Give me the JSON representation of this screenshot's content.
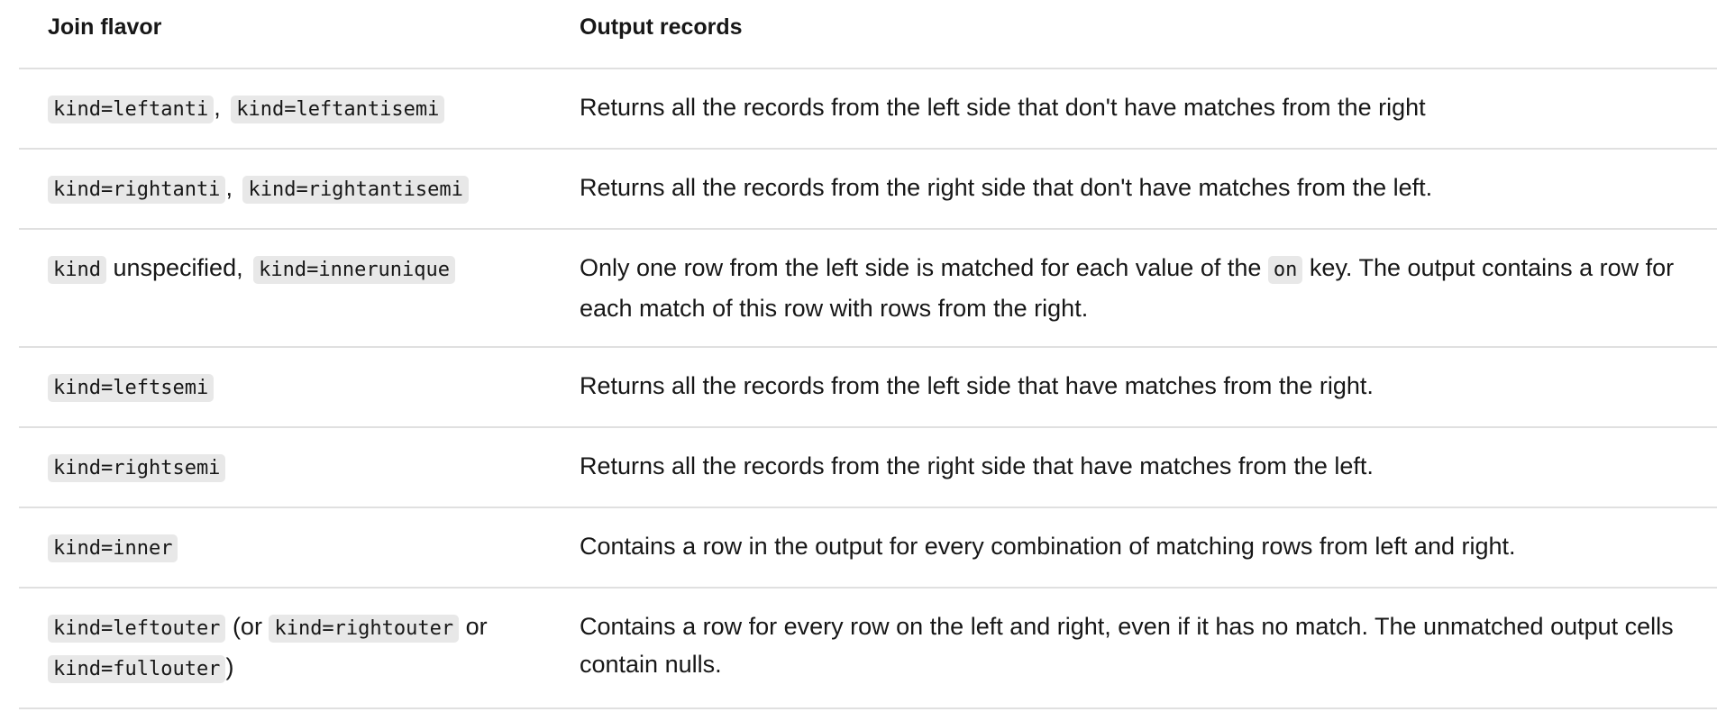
{
  "header": {
    "col1": "Join flavor",
    "col2": "Output records"
  },
  "rows": [
    {
      "flavor_code_1": "kind=leftanti",
      "flavor_sep_1": ",",
      "flavor_code_2": "kind=leftantisemi",
      "output": "Returns all the records from the left side that don't have matches from the right"
    },
    {
      "flavor_code_1": "kind=rightanti",
      "flavor_sep_1": ",",
      "flavor_code_2": "kind=rightantisemi",
      "output": "Returns all the records from the right side that don't have matches from the left."
    },
    {
      "flavor_code_1": "kind",
      "flavor_sep_1": " unspecified,",
      "flavor_code_2": "kind=innerunique",
      "output_pre": "Only one row from the left side is matched for each value of the",
      "output_code": "on",
      "output_post": "key. The output contains a row for each match of this row with rows from the right."
    },
    {
      "flavor_code_1": "kind=leftsemi",
      "output": "Returns all the records from the left side that have matches from the right."
    },
    {
      "flavor_code_1": "kind=rightsemi",
      "output": "Returns all the records from the right side that have matches from the left."
    },
    {
      "flavor_code_1": "kind=inner",
      "output": "Contains a row in the output for every combination of matching rows from left and right."
    },
    {
      "flavor_code_1": "kind=leftouter",
      "flavor_sep_1": " (or",
      "flavor_code_2": "kind=rightouter",
      "flavor_sep_2": " or",
      "flavor_code_3": "kind=fullouter",
      "flavor_sep_3": ")",
      "output": "Contains a row for every row on the left and right, even if it has no match. The unmatched output cells contain nulls."
    }
  ]
}
